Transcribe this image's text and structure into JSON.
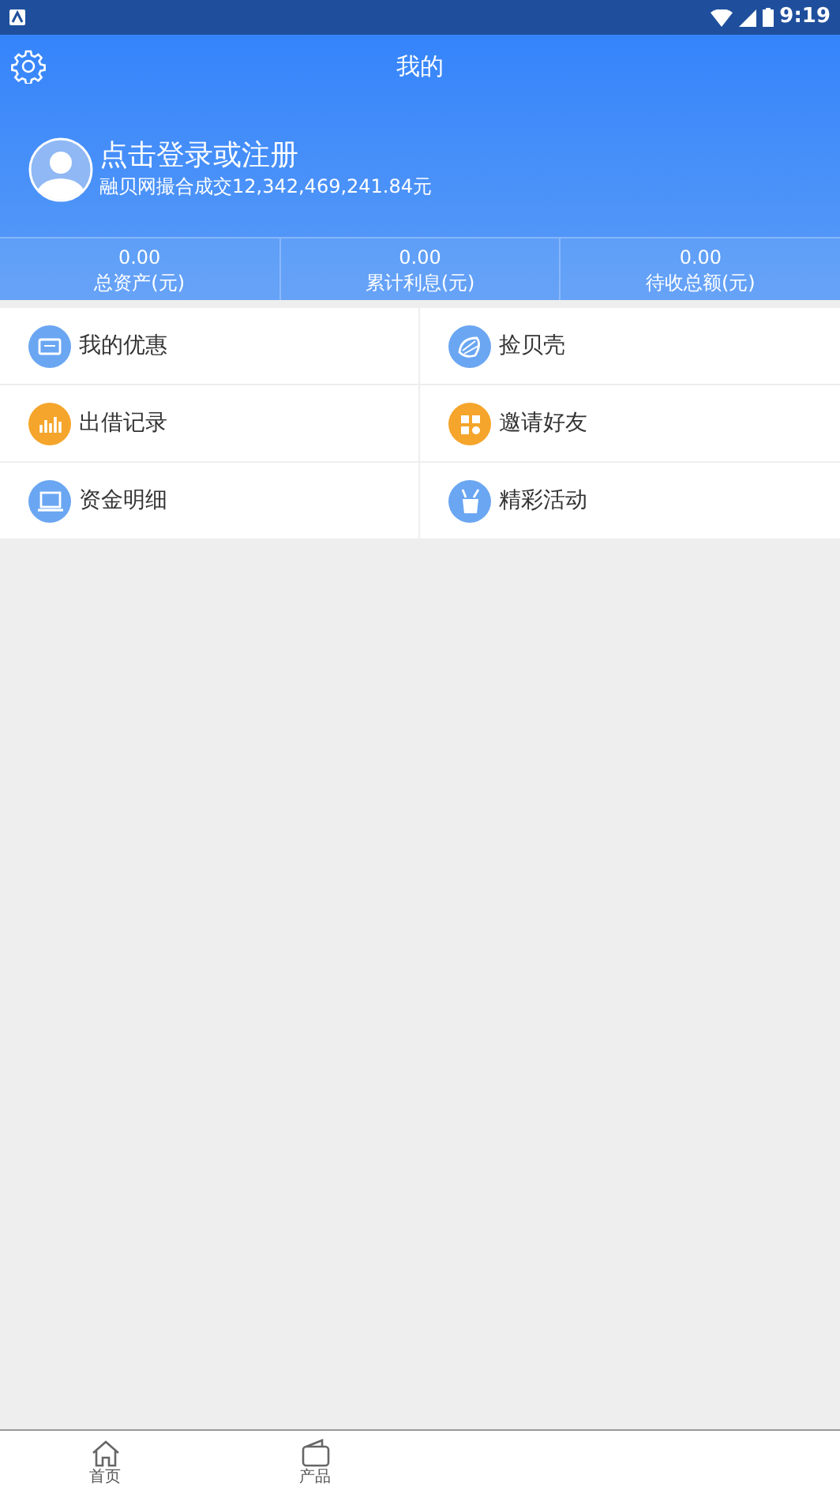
{
  "status_bar": {
    "time": "9:19"
  },
  "header": {
    "title": "我的"
  },
  "profile": {
    "login": "点击登录或注册",
    "summary": "融贝网撮合成交12,342,469,241.84元"
  },
  "stats": [
    {
      "value": "0.00",
      "label": "总资产(元)"
    },
    {
      "value": "0.00",
      "label": "累计利息(元)"
    },
    {
      "value": "0.00",
      "label": "待收总额(元)"
    }
  ],
  "menu": [
    {
      "label": "我的优惠",
      "color": "#6aa6f2"
    },
    {
      "label": "捡贝壳",
      "color": "#6aa6f2"
    },
    {
      "label": "出借记录",
      "color": "#f5a52b"
    },
    {
      "label": "邀请好友",
      "color": "#f5a52b"
    },
    {
      "label": "资金明细",
      "color": "#6aa6f2"
    },
    {
      "label": "精彩活动",
      "color": "#6aa6f2"
    }
  ],
  "tab_bar": [
    {
      "label": "首页"
    },
    {
      "label": "产品"
    }
  ]
}
